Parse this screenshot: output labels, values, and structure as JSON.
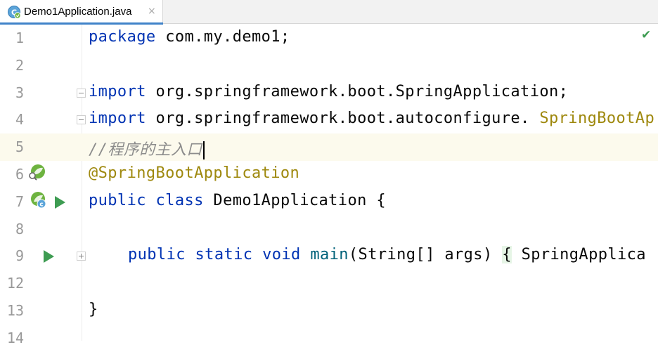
{
  "tab": {
    "file_name": "Demo1Application.java",
    "close_glyph": "×",
    "icon": "spring-class-icon"
  },
  "status": {
    "inspection_icon": "checkmark-icon",
    "inspection_glyph": "✔"
  },
  "lines": [
    {
      "number": "1",
      "tokens": [
        [
          "kw",
          "package"
        ],
        [
          "",
          "com.my.demo1;"
        ]
      ]
    },
    {
      "number": "2",
      "tokens": []
    },
    {
      "number": "3",
      "tokens": [
        [
          "kw",
          "import"
        ],
        [
          "",
          "org.springframework.boot.SpringApplication;"
        ]
      ]
    },
    {
      "number": "4",
      "tokens": [
        [
          "kw",
          "import"
        ],
        [
          "",
          "org.springframework.boot.autoconfigure."
        ],
        [
          "cls",
          "SpringBootAp"
        ]
      ]
    },
    {
      "number": "5",
      "tokens": [
        [
          "cm",
          "//程序的主入口"
        ]
      ]
    },
    {
      "number": "6",
      "tokens": [
        [
          "ann",
          "@SpringBootApplication"
        ]
      ]
    },
    {
      "number": "7",
      "tokens": [
        [
          "kw",
          "public"
        ],
        [
          "kw",
          "class"
        ],
        [
          "",
          "Demo1Application {"
        ]
      ]
    },
    {
      "number": "8",
      "tokens": []
    },
    {
      "number": "9",
      "tokens": [
        [
          "kw",
          "public"
        ],
        [
          "kw",
          "static"
        ],
        [
          "kw",
          "void"
        ],
        [
          "fn",
          "main"
        ],
        [
          "",
          "(String[] args)"
        ],
        [
          "brace",
          "{"
        ],
        [
          "",
          "SpringApplica"
        ]
      ]
    },
    {
      "number": "12",
      "tokens": []
    },
    {
      "number": "13",
      "tokens": [
        [
          "",
          "}"
        ]
      ]
    },
    {
      "number": "14",
      "tokens": []
    }
  ],
  "colors": {
    "keyword": "#0033b3",
    "annotation": "#9e880d",
    "comment": "#8c8c8c",
    "method": "#00627a",
    "current_line": "#fcfaed",
    "run_icon": "#3e9c52",
    "tab_underline": "#4083c9"
  }
}
